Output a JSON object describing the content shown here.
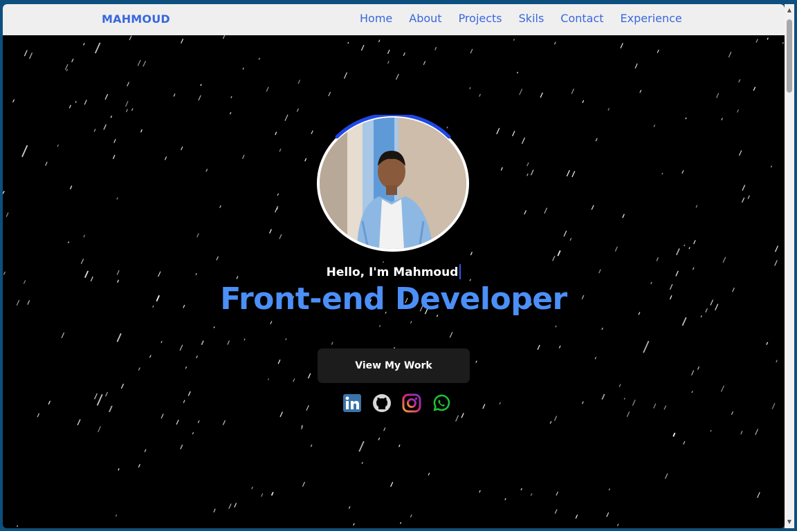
{
  "navbar": {
    "brand": "MAHMOUD",
    "links": [
      "Home",
      "About",
      "Projects",
      "Skils",
      "Contact",
      "Experience"
    ]
  },
  "hero": {
    "greeting": "Hello, I'm Mahmoud",
    "role": "Front-end Developer",
    "cta_label": "View My Work",
    "socials": [
      "linkedin-icon",
      "github-icon",
      "instagram-icon",
      "whatsapp-icon"
    ]
  },
  "colors": {
    "accent": "#3a67dd",
    "role_text": "#4b8ff7",
    "background": "#000000",
    "navbar": "#efefef"
  }
}
